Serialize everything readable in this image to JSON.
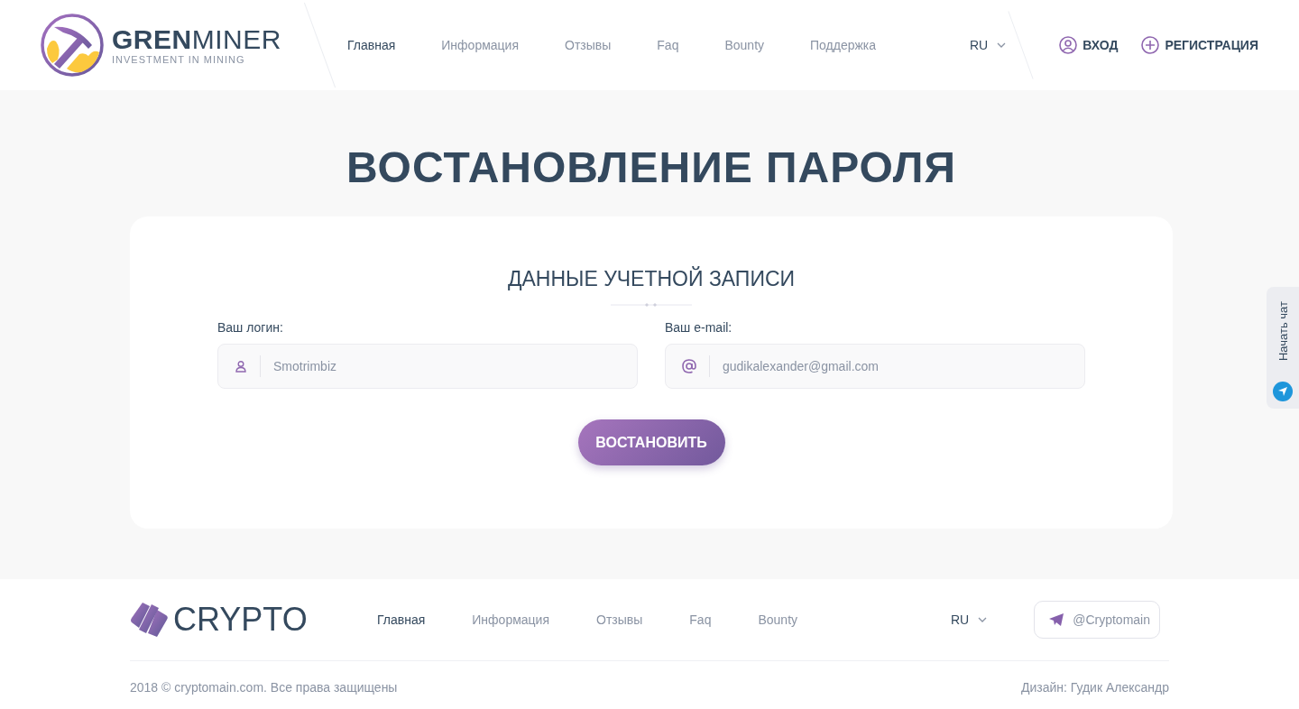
{
  "header": {
    "logo": {
      "name_bold": "GREN",
      "name_light": "MINER",
      "tagline": "INVESTMENT IN MINING"
    },
    "nav": [
      {
        "label": "Главная",
        "selected": true
      },
      {
        "label": "Информация",
        "selected": false
      },
      {
        "label": "Отзывы",
        "selected": false
      },
      {
        "label": "Faq",
        "selected": false
      },
      {
        "label": "Bounty",
        "selected": false
      },
      {
        "label": "Поддержка",
        "selected": false
      }
    ],
    "language": "RU",
    "login": "ВХОД",
    "register": "РЕГИСТРАЦИЯ"
  },
  "page_title": "ВОСТАНОВЛЕНИЕ ПАРОЛЯ",
  "form": {
    "title": "ДАННЫЕ УЧЕТНОЙ ЗАПИСИ",
    "fields": [
      {
        "kind": "user",
        "label": "Ваш логин:",
        "value": "Smotrimbiz"
      },
      {
        "kind": "email",
        "label": "Ваш e-mail:",
        "value": "gudikalexander@gmail.com"
      }
    ],
    "submit": "ВОСТАНОВИТЬ"
  },
  "chat_tab": "Начать чат",
  "footer": {
    "logo": "CRYPTO",
    "nav": [
      {
        "label": "Главная",
        "selected": true
      },
      {
        "label": "Информация",
        "selected": false
      },
      {
        "label": "Отзывы",
        "selected": false
      },
      {
        "label": "Faq",
        "selected": false
      },
      {
        "label": "Bounty",
        "selected": false
      }
    ],
    "language": "RU",
    "telegram": "@Cryptomain",
    "copyright": "2018 © cryptomain.com.  Все права защищены",
    "credit": "Дизайн: Гудик Александр"
  }
}
